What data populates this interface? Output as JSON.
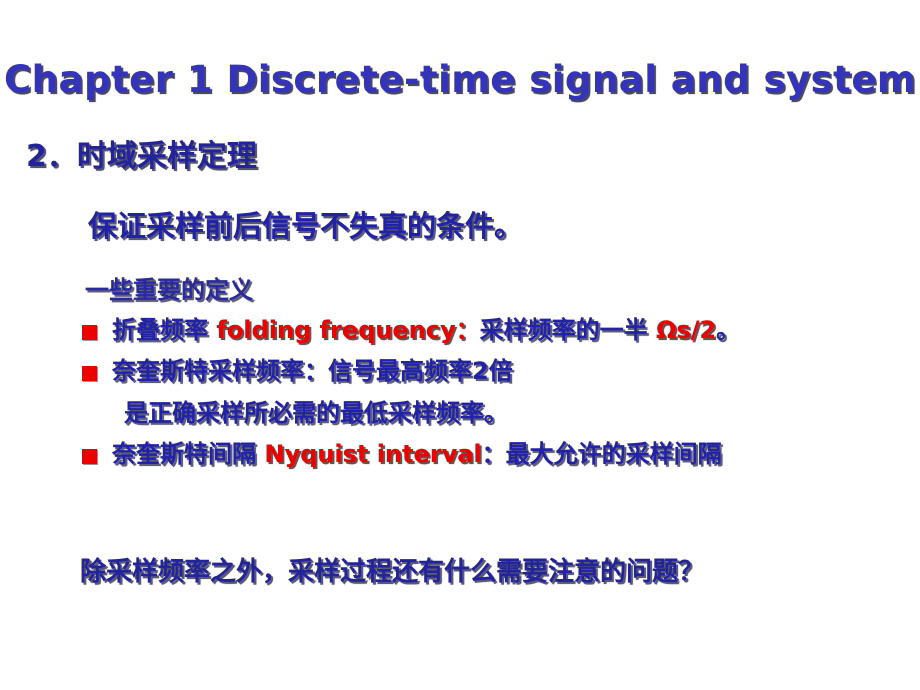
{
  "slide": {
    "background_color": "#ffffff",
    "title": "Chapter 1 Discrete-time signal and system",
    "title_color": "#3333bb",
    "section_heading": "2．时域采样定理",
    "section_heading_color": "#23239c",
    "statement": "保证采样前后信号不失真的条件。",
    "subheader": "一些重要的定义",
    "bullet_marker_color": "#ee0000",
    "accent_red": "#ee0000",
    "accent_blue": "#2222a8",
    "bullets": [
      {
        "marker": "red-square-bullet",
        "segments": [
          {
            "text": "折叠频率 ",
            "color": "blue"
          },
          {
            "text": "folding frequency：",
            "color": "red"
          },
          {
            "text": "采样频率的一半 ",
            "color": "blue"
          },
          {
            "text": "Ωs/2",
            "color": "red"
          },
          {
            "text": "。",
            "color": "blue"
          }
        ]
      },
      {
        "marker": "red-square-bullet",
        "segments": [
          {
            "text": "奈奎斯特采样频率：信号最高频率2倍",
            "color": "blue"
          }
        ],
        "continuation": "是正确采样所必需的最低采样频率。"
      },
      {
        "marker": "red-square-bullet",
        "segments": [
          {
            "text": "奈奎斯特间隔 ",
            "color": "blue"
          },
          {
            "text": "Nyquist interval",
            "color": "red"
          },
          {
            "text": "：最大允许的采样间隔",
            "color": "blue"
          }
        ]
      }
    ],
    "closing_question": "除采样频率之外，采样过程还有什么需要注意的问题？"
  }
}
